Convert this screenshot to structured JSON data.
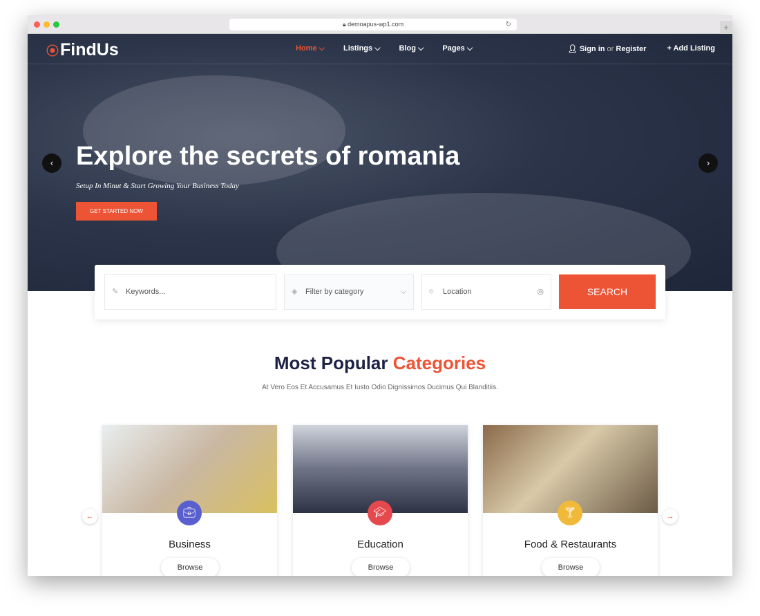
{
  "browser": {
    "url": "demoapus-wp1.com"
  },
  "nav": {
    "logo": "FindUs",
    "items": [
      {
        "label": "Home ⌵"
      },
      {
        "label": "Listings ⌵"
      },
      {
        "label": "Blog ⌵"
      },
      {
        "label": "Pages ⌵"
      }
    ],
    "sign_in": "Sign in",
    "or": "or",
    "register": "Register",
    "add_listing": "Add Listing"
  },
  "hero": {
    "title": "Explore the secrets of romania",
    "subtitle": "Setup In Minut & Start Growing Your Business Today",
    "cta": "GET STARTED NOW"
  },
  "search": {
    "keywords_placeholder": "Keywords...",
    "category": "Filter by category",
    "location_placeholder": "Location",
    "button": "SEARCH"
  },
  "categories": {
    "title_a": "Most Popular",
    "title_b": "Categories",
    "description": "At Vero Eos Et Accusamus Et Iusto Odio Dignissimos Ducimus Qui Blanditiis.",
    "browse": "Browse",
    "items": [
      {
        "name": "Business",
        "color": "#5a5fcf"
      },
      {
        "name": "Education",
        "color": "#e5484d"
      },
      {
        "name": "Food & Restaurants",
        "color": "#f0b93a"
      }
    ]
  },
  "colors": {
    "accent": "#ec5435",
    "dark": "#1d2245"
  }
}
